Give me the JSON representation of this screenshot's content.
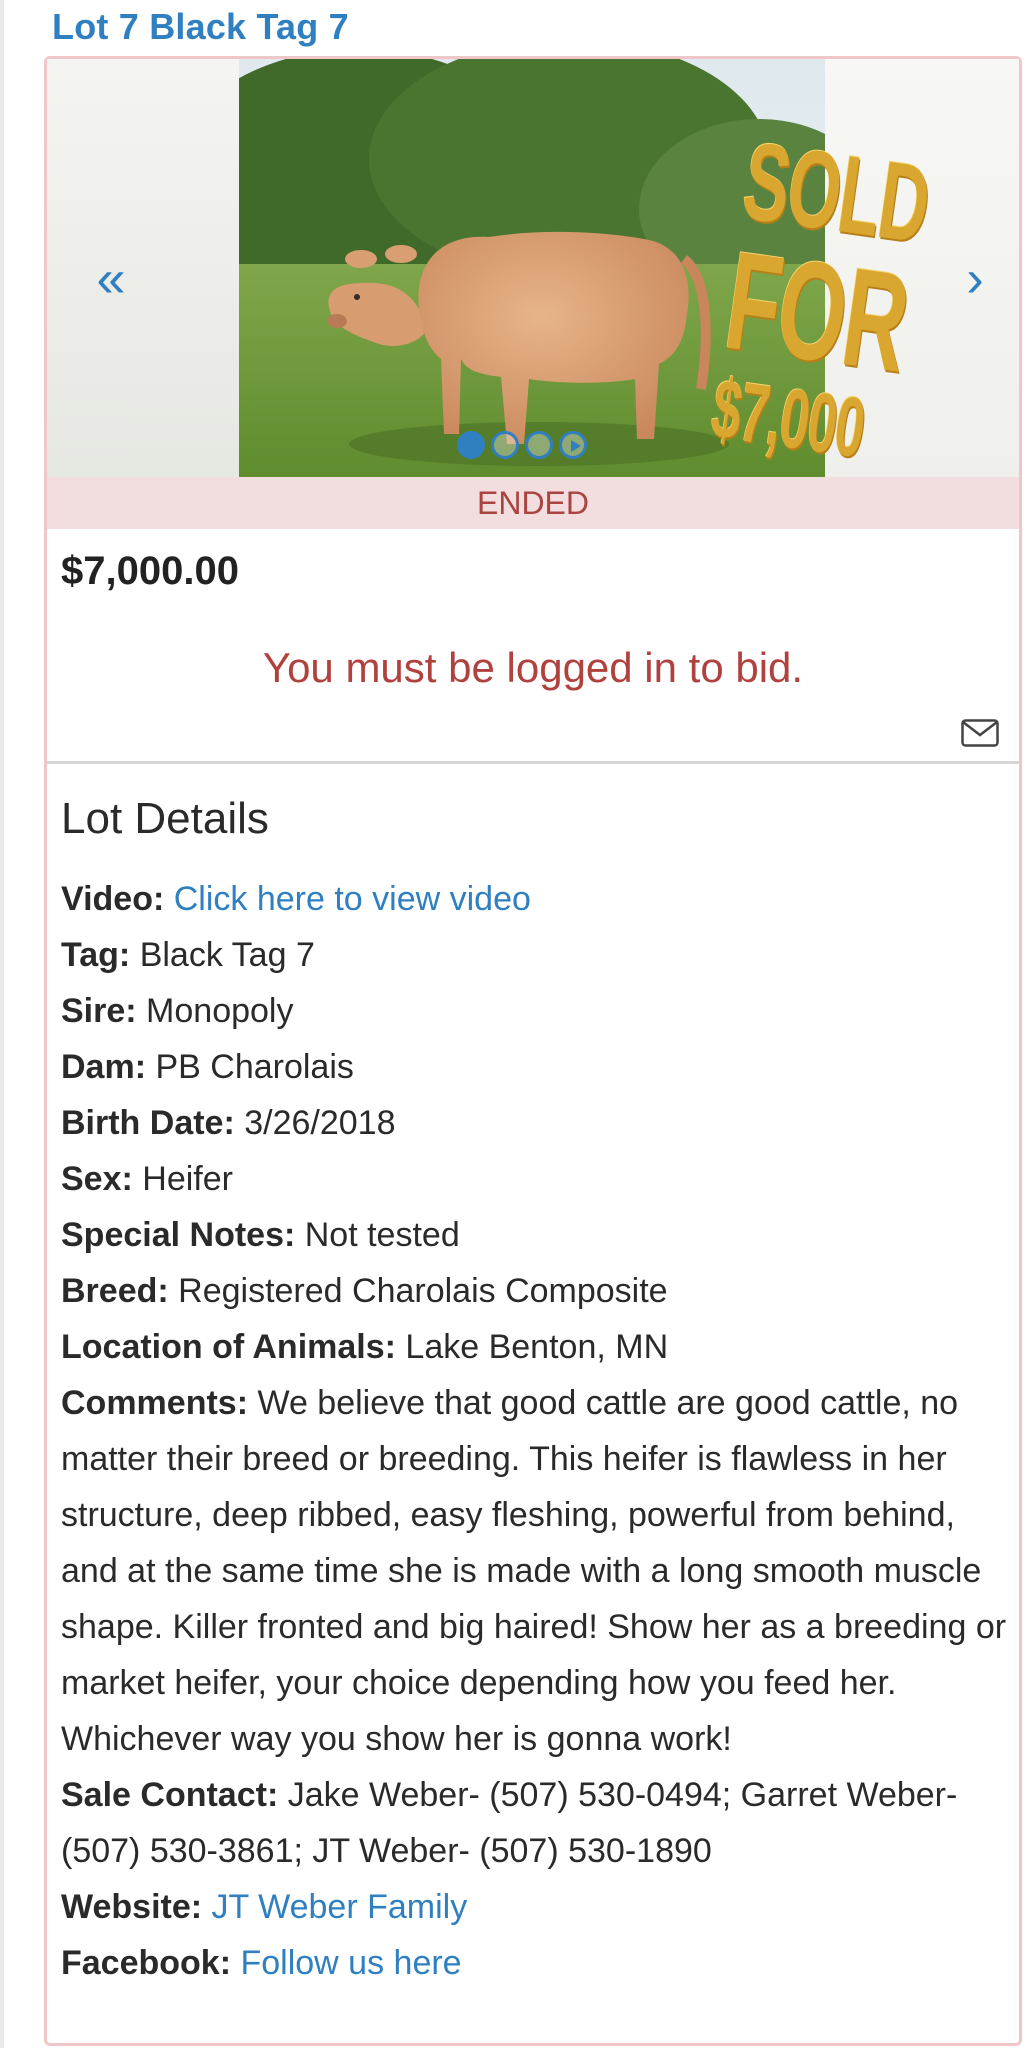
{
  "lot": {
    "title": "Lot 7 Black Tag 7"
  },
  "carousel": {
    "prev_icon": "«",
    "next_icon": "›",
    "slide_count": 4,
    "active_index": 0,
    "overlay": {
      "line1": "SOLD",
      "line2": "FOR",
      "line3": "$7,000"
    }
  },
  "status": {
    "label": "ENDED"
  },
  "bid": {
    "price": "$7,000.00",
    "login_message": "You must be logged in to bid."
  },
  "details": {
    "heading": "Lot Details",
    "video_label": "Video:",
    "video_link": "Click here to view video",
    "tag_label": "Tag:",
    "tag_value": "Black Tag 7",
    "sire_label": "Sire:",
    "sire_value": "Monopoly",
    "dam_label": "Dam:",
    "dam_value": "PB Charolais",
    "birth_label": "Birth Date:",
    "birth_value": "3/26/2018",
    "sex_label": "Sex:",
    "sex_value": "Heifer",
    "notes_label": "Special Notes:",
    "notes_value": "Not tested",
    "breed_label": "Breed:",
    "breed_value": "Registered Charolais Composite",
    "location_label": "Location of Animals:",
    "location_value": "Lake Benton, MN",
    "comments_label": "Comments:",
    "comments_value": "We believe that good cattle are good cattle, no matter their breed or breeding. This heifer is flawless in her structure, deep ribbed, easy fleshing, powerful from behind, and at the same time she is made with a long smooth muscle shape. Killer fronted and big haired! Show her as a breeding or market heifer, your choice depending how you feed her. Whichever way you show her is gonna work!",
    "contact_label": "Sale Contact:",
    "contact_value": "Jake Weber- (507) 530-0494; Garret Weber- (507) 530-3861; JT Weber- (507) 530-1890",
    "website_label": "Website:",
    "website_link": "JT Weber Family",
    "facebook_label": "Facebook:",
    "facebook_link": "Follow us here"
  },
  "colors": {
    "link": "#2f7fc1",
    "card_border": "#efc7c9",
    "status_bg": "#f2dede",
    "status_text": "#a94442",
    "login_text": "#b0413e",
    "gold": "#d9a730"
  },
  "icons": {
    "prev": "double-chevron-left-icon",
    "next": "chevron-right-icon",
    "mail": "envelope-icon",
    "play": "play-icon"
  }
}
